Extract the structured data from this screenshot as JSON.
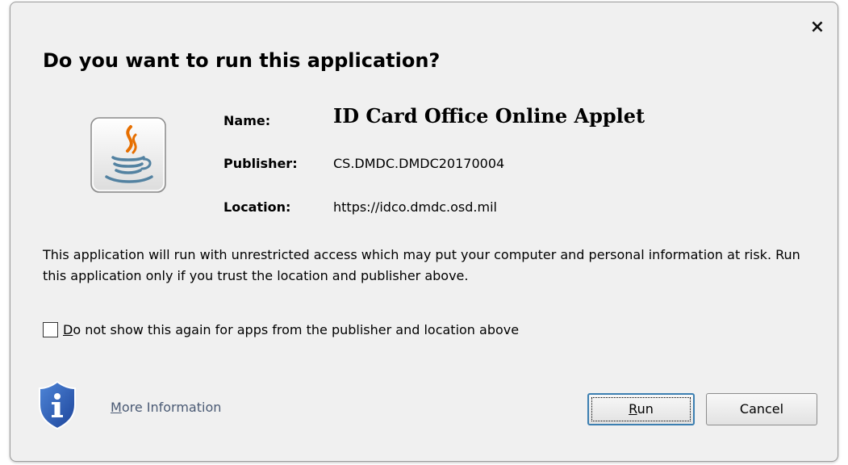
{
  "dialog": {
    "title": "Do you want to run this application?",
    "close_symbol": "×"
  },
  "app_info": {
    "name_label": "Name:",
    "name_value": "ID Card Office Online Applet",
    "publisher_label": "Publisher:",
    "publisher_value": "CS.DMDC.DMDC20170004",
    "location_label": "Location:",
    "location_value": "https://idco.dmdc.osd.mil"
  },
  "warning_text": "This application will run with unrestricted access which may put your computer and personal information at risk. Run this application only if you trust the location and publisher above.",
  "checkbox": {
    "mnemonic": "D",
    "label_rest": "o not show this again for apps from the publisher and location above",
    "checked": false
  },
  "more_info": {
    "mnemonic": "M",
    "label_rest": "ore Information"
  },
  "buttons": {
    "run_mnemonic": "R",
    "run_rest": "un",
    "cancel_label": "Cancel"
  },
  "icons": {
    "app_icon": "java-cup-icon",
    "info_icon": "shield-info-icon"
  },
  "colors": {
    "dialog_bg": "#f0f0f0",
    "link": "#4a5a74",
    "focus_border": "#3c7fb1",
    "java_orange": "#e76f00",
    "java_blue": "#5382a1",
    "shield_blue": "#2a5bb0"
  }
}
